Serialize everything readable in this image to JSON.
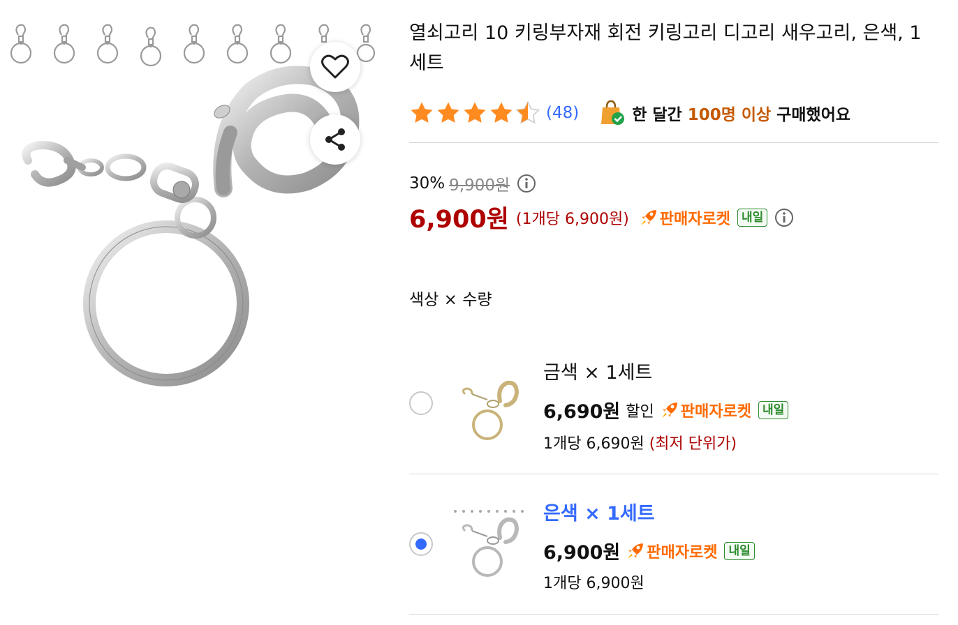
{
  "product": {
    "title": "열쇠고리 10 키링부자재 회전 키링고리 디고리 새우고리, 은색, 1세트",
    "rating": 4.5,
    "review_count": "(48)",
    "purchase_prefix": "한 달간 ",
    "purchase_highlight": "100명 이상",
    "purchase_suffix": " 구매했어요"
  },
  "pricing": {
    "discount_rate": "30%",
    "original_price": "9,900원",
    "sale_price": "6,900원",
    "unit_price": "(1개당 6,900원)",
    "delivery_label": "판매자로켓",
    "delivery_badge": "내일"
  },
  "options_label": "색상 × 수량",
  "options": [
    {
      "name": "금색 × 1세트",
      "price": "6,690원",
      "discount_label": "할인",
      "delivery_label": "판매자로켓",
      "delivery_badge": "내일",
      "unit_price": "1개당 6,690원 ",
      "unit_note": "(최저 단위가)",
      "selected": false,
      "color": "#c9b37a"
    },
    {
      "name": "은색 × 1세트",
      "price": "6,900원",
      "delivery_label": "판매자로켓",
      "delivery_badge": "내일",
      "unit_price": "1개당 6,900원",
      "selected": true,
      "color": "#b8b8b8"
    }
  ],
  "icons": {
    "wishlist": "heart-icon",
    "share": "share-icon",
    "info": "info-icon",
    "rocket": "rocket-icon",
    "bag": "shopping-bag-icon"
  },
  "colors": {
    "accent_blue": "#346aff",
    "price_red": "#ae0000",
    "rocket_orange": "#ff6a00",
    "badge_green": "#2e8b2e",
    "star_orange": "#ff8a1f"
  }
}
